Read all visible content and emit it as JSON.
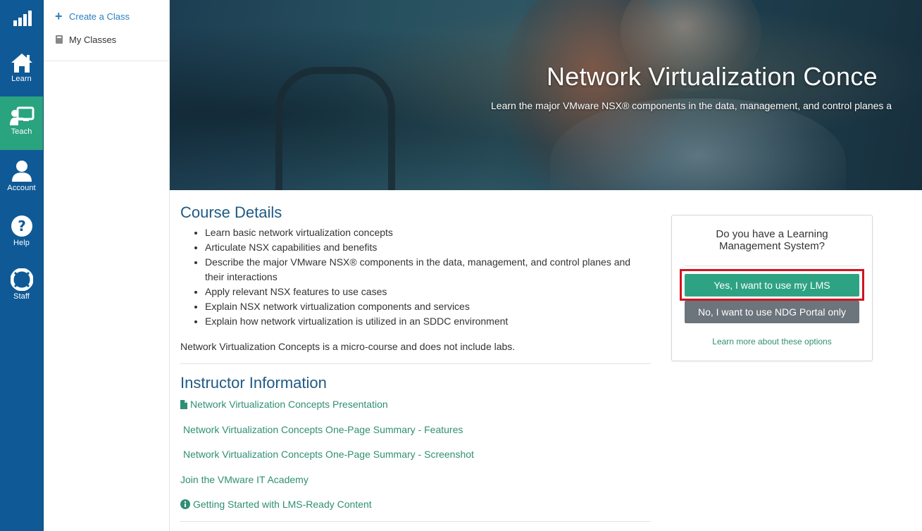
{
  "rail": {
    "items": [
      {
        "label": "",
        "icon": "signal-bars-icon"
      },
      {
        "label": "Learn",
        "icon": "home-icon"
      },
      {
        "label": "Teach",
        "icon": "teach-board-icon",
        "active": true
      },
      {
        "label": "Account",
        "icon": "user-icon"
      },
      {
        "label": "Help",
        "icon": "question-circle-icon"
      },
      {
        "label": "Staff",
        "icon": "life-ring-icon"
      }
    ]
  },
  "subnav": {
    "create_class": "Create a Class",
    "my_classes": "My Classes"
  },
  "hero": {
    "title": "Network Virtualization Conce",
    "subtitle": "Learn the major VMware NSX® components in the data, management, and control planes a"
  },
  "course_details": {
    "heading": "Course Details",
    "bullets": [
      "Learn basic network virtualization concepts",
      "Articulate NSX capabilities and benefits",
      "Describe the major VMware NSX® components in the data, management, and control planes and their interactions",
      "Apply relevant NSX features to use cases",
      "Explain NSX network virtualization components and services",
      "Explain how network virtualization is utilized in an SDDC environment"
    ],
    "note": "Network Virtualization Concepts is a micro-course and does not include labs."
  },
  "instructor": {
    "heading": "Instructor Information",
    "links": [
      {
        "label": "Network Virtualization Concepts Presentation",
        "icon": "file-icon"
      },
      {
        "label": "Network Virtualization Concepts One-Page Summary - Features"
      },
      {
        "label": "Network Virtualization Concepts One-Page Summary - Screenshot"
      },
      {
        "label": "Join the VMware IT Academy"
      },
      {
        "label": "Getting Started with LMS-Ready Content",
        "icon": "info-circle-icon"
      }
    ]
  },
  "lms": {
    "question": "Do you have a Learning Management System?",
    "yes_label": "Yes, I want to use my LMS",
    "no_label": "No, I want to use NDG Portal only",
    "learn_more": "Learn more about these options"
  },
  "colors": {
    "rail": "#0f5a96",
    "active": "#2aa37f",
    "heading": "#1f5a84",
    "link": "#2f8f74",
    "highlight": "#d0151f"
  }
}
